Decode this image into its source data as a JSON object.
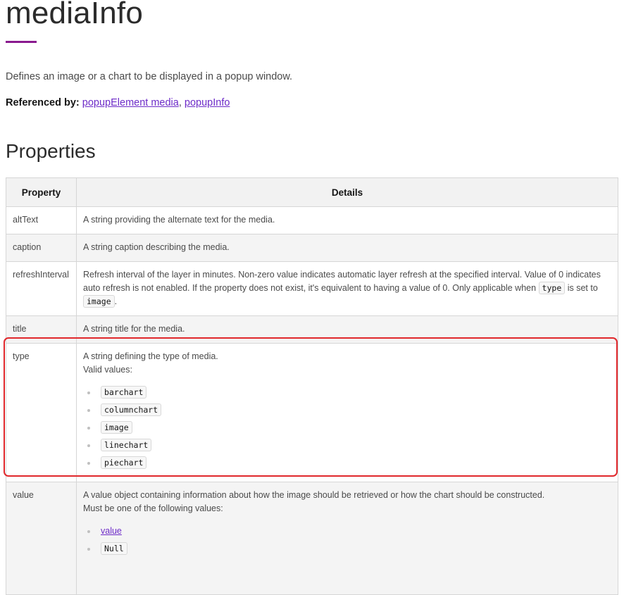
{
  "page": {
    "title": "mediaInfo",
    "description": "Defines an image or a chart to be displayed in a popup window.",
    "referenced_label": "Referenced by:",
    "referenced_links": [
      "popupElement media",
      "popupInfo"
    ],
    "referenced_separator": ", ",
    "section_title": "Properties",
    "accent_color": "#8a1a8f",
    "link_color": "#6e2cc8",
    "highlight_color": "#e0282c"
  },
  "table": {
    "headers": [
      "Property",
      "Details"
    ],
    "rows": {
      "altText": {
        "name": "altText",
        "details": "A string providing the alternate text for the media."
      },
      "caption": {
        "name": "caption",
        "details": "A string caption describing the media."
      },
      "refreshInterval": {
        "name": "refreshInterval",
        "details_part1": "Refresh interval of the layer in minutes. Non-zero value indicates automatic layer refresh at the specified interval. Value of 0 indicates auto refresh is not enabled. If the property does not exist, it's equivalent to having a value of 0. Only applicable when ",
        "code1": "type",
        "details_part2": " is set to ",
        "code2": "image",
        "details_part3": "."
      },
      "title": {
        "name": "title",
        "details": "A string title for the media."
      },
      "type": {
        "name": "type",
        "details": "A string defining the type of media.",
        "valid_label": "Valid values:",
        "values": [
          "barchart",
          "columnchart",
          "image",
          "linechart",
          "piechart"
        ]
      },
      "value": {
        "name": "value",
        "details": "A value object containing information about how the image should be retrieved or how the chart should be constructed.",
        "must_label": "Must be one of the following values:",
        "link_value": "value",
        "code_value": "Null"
      }
    }
  }
}
